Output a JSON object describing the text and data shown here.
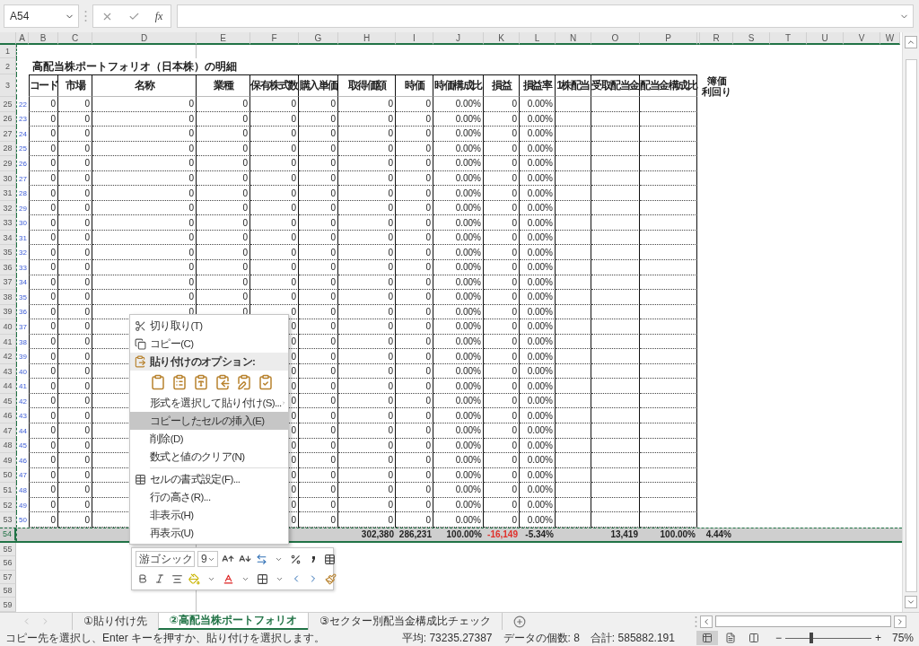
{
  "formula_bar": {
    "name_box": "A54",
    "formula_button": "fx"
  },
  "columns": [
    "A",
    "B",
    "C",
    "D",
    "E",
    "F",
    "G",
    "H",
    "I",
    "J",
    "K",
    "L",
    "N",
    "O",
    "P",
    "R",
    "S",
    "T",
    "U",
    "V",
    "W"
  ],
  "top_rows": {
    "blank_row": "1",
    "title_row": "2",
    "title": "高配当株ポートフォリオ（日本株）の明細",
    "header_row": "3",
    "headers": [
      "コード",
      "市場",
      "名称",
      "業種",
      "保有株式数",
      "購入単価",
      "取得価額",
      "時価",
      "時価構成比",
      "損益",
      "損益率",
      "1株配当",
      "受取配当金",
      "配当金構成比"
    ],
    "extra_header": [
      "簿価",
      "利回り"
    ]
  },
  "rows": [
    {
      "row": "25",
      "a": "22",
      "selected": false,
      "cells": [
        "0",
        "0",
        "0",
        "0",
        "0",
        "0",
        "0",
        "0",
        "0.00%",
        "0",
        "0.00%"
      ]
    },
    {
      "row": "26",
      "a": "23",
      "selected": false,
      "cells": [
        "0",
        "0",
        "0",
        "0",
        "0",
        "0",
        "0",
        "0",
        "0.00%",
        "0",
        "0.00%"
      ]
    },
    {
      "row": "27",
      "a": "24",
      "selected": false,
      "cells": [
        "0",
        "0",
        "0",
        "0",
        "0",
        "0",
        "0",
        "0",
        "0.00%",
        "0",
        "0.00%"
      ]
    },
    {
      "row": "28",
      "a": "25",
      "selected": false,
      "cells": [
        "0",
        "0",
        "0",
        "0",
        "0",
        "0",
        "0",
        "0",
        "0.00%",
        "0",
        "0.00%"
      ]
    },
    {
      "row": "29",
      "a": "26",
      "selected": false,
      "cells": [
        "0",
        "0",
        "0",
        "0",
        "0",
        "0",
        "0",
        "0",
        "0.00%",
        "0",
        "0.00%"
      ]
    },
    {
      "row": "30",
      "a": "27",
      "selected": false,
      "cells": [
        "0",
        "0",
        "0",
        "0",
        "0",
        "0",
        "0",
        "0",
        "0.00%",
        "0",
        "0.00%"
      ]
    },
    {
      "row": "31",
      "a": "28",
      "selected": false,
      "cells": [
        "0",
        "0",
        "0",
        "0",
        "0",
        "0",
        "0",
        "0",
        "0.00%",
        "0",
        "0.00%"
      ]
    },
    {
      "row": "32",
      "a": "29",
      "selected": false,
      "cells": [
        "0",
        "0",
        "0",
        "0",
        "0",
        "0",
        "0",
        "0",
        "0.00%",
        "0",
        "0.00%"
      ]
    },
    {
      "row": "33",
      "a": "30",
      "selected": false,
      "cells": [
        "0",
        "0",
        "0",
        "0",
        "0",
        "0",
        "0",
        "0",
        "0.00%",
        "0",
        "0.00%"
      ]
    },
    {
      "row": "34",
      "a": "31",
      "selected": false,
      "cells": [
        "0",
        "0",
        "0",
        "0",
        "0",
        "0",
        "0",
        "0",
        "0.00%",
        "0",
        "0.00%"
      ]
    },
    {
      "row": "35",
      "a": "32",
      "selected": false,
      "cells": [
        "0",
        "0",
        "0",
        "0",
        "0",
        "0",
        "0",
        "0",
        "0.00%",
        "0",
        "0.00%"
      ]
    },
    {
      "row": "36",
      "a": "33",
      "selected": false,
      "cells": [
        "0",
        "0",
        "0",
        "0",
        "0",
        "0",
        "0",
        "0",
        "0.00%",
        "0",
        "0.00%"
      ]
    },
    {
      "row": "37",
      "a": "34",
      "selected": false,
      "cells": [
        "0",
        "0",
        "0",
        "0",
        "0",
        "0",
        "0",
        "0",
        "0.00%",
        "0",
        "0.00%"
      ]
    },
    {
      "row": "38",
      "a": "35",
      "selected": false,
      "cells": [
        "0",
        "0",
        "0",
        "0",
        "0",
        "0",
        "0",
        "0",
        "0.00%",
        "0",
        "0.00%"
      ]
    },
    {
      "row": "39",
      "a": "36",
      "selected": false,
      "cells": [
        "0",
        "0",
        "0",
        "0",
        "0",
        "0",
        "0",
        "0",
        "0.00%",
        "0",
        "0.00%"
      ]
    },
    {
      "row": "40",
      "a": "37",
      "selected": false,
      "kind": "covered",
      "cells": [
        "0",
        "0",
        "0",
        "0",
        "0",
        "0",
        "0.00%",
        "0",
        "0.00%"
      ]
    },
    {
      "row": "41",
      "a": "38",
      "selected": false,
      "kind": "covered",
      "cells": [
        "0",
        "0",
        "0",
        "0",
        "0",
        "0",
        "0.00%",
        "0",
        "0.00%"
      ]
    },
    {
      "row": "42",
      "a": "39",
      "selected": false,
      "kind": "covered",
      "cells": [
        "0",
        "0",
        "0",
        "0",
        "0",
        "0",
        "0.00%",
        "0",
        "0.00%"
      ]
    },
    {
      "row": "43",
      "a": "40",
      "selected": false,
      "kind": "covered",
      "cells": [
        "0",
        "0",
        "0",
        "0",
        "0",
        "0",
        "0.00%",
        "0",
        "0.00%"
      ]
    },
    {
      "row": "44",
      "a": "41",
      "selected": false,
      "kind": "covered",
      "cells": [
        "0",
        "0",
        "0",
        "0",
        "0",
        "0",
        "0.00%",
        "0",
        "0.00%"
      ]
    },
    {
      "row": "45",
      "a": "42",
      "selected": false,
      "kind": "covered",
      "cells": [
        "0",
        "0",
        "0",
        "0",
        "0",
        "0",
        "0.00%",
        "0",
        "0.00%"
      ]
    },
    {
      "row": "46",
      "a": "43",
      "selected": false,
      "kind": "covered",
      "cells": [
        "0",
        "0",
        "0",
        "0",
        "0",
        "0",
        "0.00%",
        "0",
        "0.00%"
      ]
    },
    {
      "row": "47",
      "a": "44",
      "selected": false,
      "kind": "covered",
      "cells": [
        "0",
        "0",
        "0",
        "0",
        "0",
        "0",
        "0.00%",
        "0",
        "0.00%"
      ]
    },
    {
      "row": "48",
      "a": "45",
      "selected": false,
      "kind": "covered",
      "cells": [
        "0",
        "0",
        "0",
        "0",
        "0",
        "0",
        "0.00%",
        "0",
        "0.00%"
      ]
    },
    {
      "row": "49",
      "a": "46",
      "selected": false,
      "kind": "covered",
      "cells": [
        "0",
        "0",
        "0",
        "0",
        "0",
        "0",
        "0.00%",
        "0",
        "0.00%"
      ]
    },
    {
      "row": "50",
      "a": "47",
      "selected": false,
      "kind": "covered",
      "cells": [
        "0",
        "0",
        "0",
        "0",
        "0",
        "0",
        "0.00%",
        "0",
        "0.00%"
      ]
    },
    {
      "row": "51",
      "a": "48",
      "selected": false,
      "kind": "covered",
      "cells": [
        "0",
        "0",
        "0",
        "0",
        "0",
        "0",
        "0.00%",
        "0",
        "0.00%"
      ]
    },
    {
      "row": "52",
      "a": "49",
      "selected": false,
      "kind": "covered",
      "cells": [
        "0",
        "0",
        "0",
        "0",
        "0",
        "0",
        "0.00%",
        "0",
        "0.00%"
      ]
    },
    {
      "row": "53",
      "a": "50",
      "selected": false,
      "kind": "covered",
      "cells": [
        "0",
        "0",
        "0",
        "0",
        "0",
        "0",
        "0.00%",
        "0",
        "0.00%"
      ]
    }
  ],
  "total": {
    "row": "54",
    "selected": true,
    "acquisition": "302,380",
    "market_value": "286,231",
    "market_share": "100.00%",
    "profit_loss": {
      "text": "-16,149",
      "negative": true
    },
    "profit_rate": "-5.34%",
    "dividends": "13,419",
    "dividend_share": "100.00%",
    "yield": "4.44%"
  },
  "empty_rows": [
    "55",
    "56",
    "57",
    "58",
    "59"
  ],
  "context_menu": [
    {
      "kind": "item",
      "label": "切り取り(T)",
      "selected": false
    },
    {
      "kind": "item",
      "label": "コピー(C)",
      "selected": false
    },
    {
      "kind": "header",
      "label": "貼り付けのオプション:"
    },
    {
      "kind": "paste_options"
    },
    {
      "kind": "submenu",
      "label": "形式を選択して貼り付け(S)...",
      "selected": false
    },
    {
      "kind": "item",
      "label": "コピーしたセルの挿入(E)",
      "selected": true
    },
    {
      "kind": "item",
      "label": "削除(D)",
      "selected": false
    },
    {
      "kind": "item",
      "label": "数式と値のクリア(N)",
      "selected": false
    },
    {
      "kind": "separator"
    },
    {
      "kind": "item",
      "label": "セルの書式設定(F)...",
      "selected": false
    },
    {
      "kind": "item",
      "label": "行の高さ(R)...",
      "selected": false
    },
    {
      "kind": "item",
      "label": "非表示(H)",
      "selected": false
    },
    {
      "kind": "item",
      "label": "再表示(U)",
      "selected": false
    }
  ],
  "mini_toolbar": {
    "font": "游ゴシック",
    "size": "9"
  },
  "sheet_tabs": [
    {
      "label": "①貼り付け先",
      "selected": false
    },
    {
      "label": "②高配当株ポートフォリオ",
      "selected": true
    },
    {
      "label": "③セクター別配当金構成比チェック",
      "selected": false
    }
  ],
  "status_bar": {
    "message": "コピー先を選択し、Enter キーを押すか、貼り付けを選択します。",
    "average": "平均: 73235.27387",
    "count": "データの個数: 8",
    "sum": "合計: 585882.191",
    "views": [
      {
        "kind": "normal",
        "selected": true
      },
      {
        "kind": "page_layout",
        "selected": false
      },
      {
        "kind": "page_break",
        "selected": false
      }
    ],
    "zoom_out": "−",
    "zoom_in": "+",
    "zoom": {
      "level": 0.3,
      "label": "75%"
    }
  }
}
